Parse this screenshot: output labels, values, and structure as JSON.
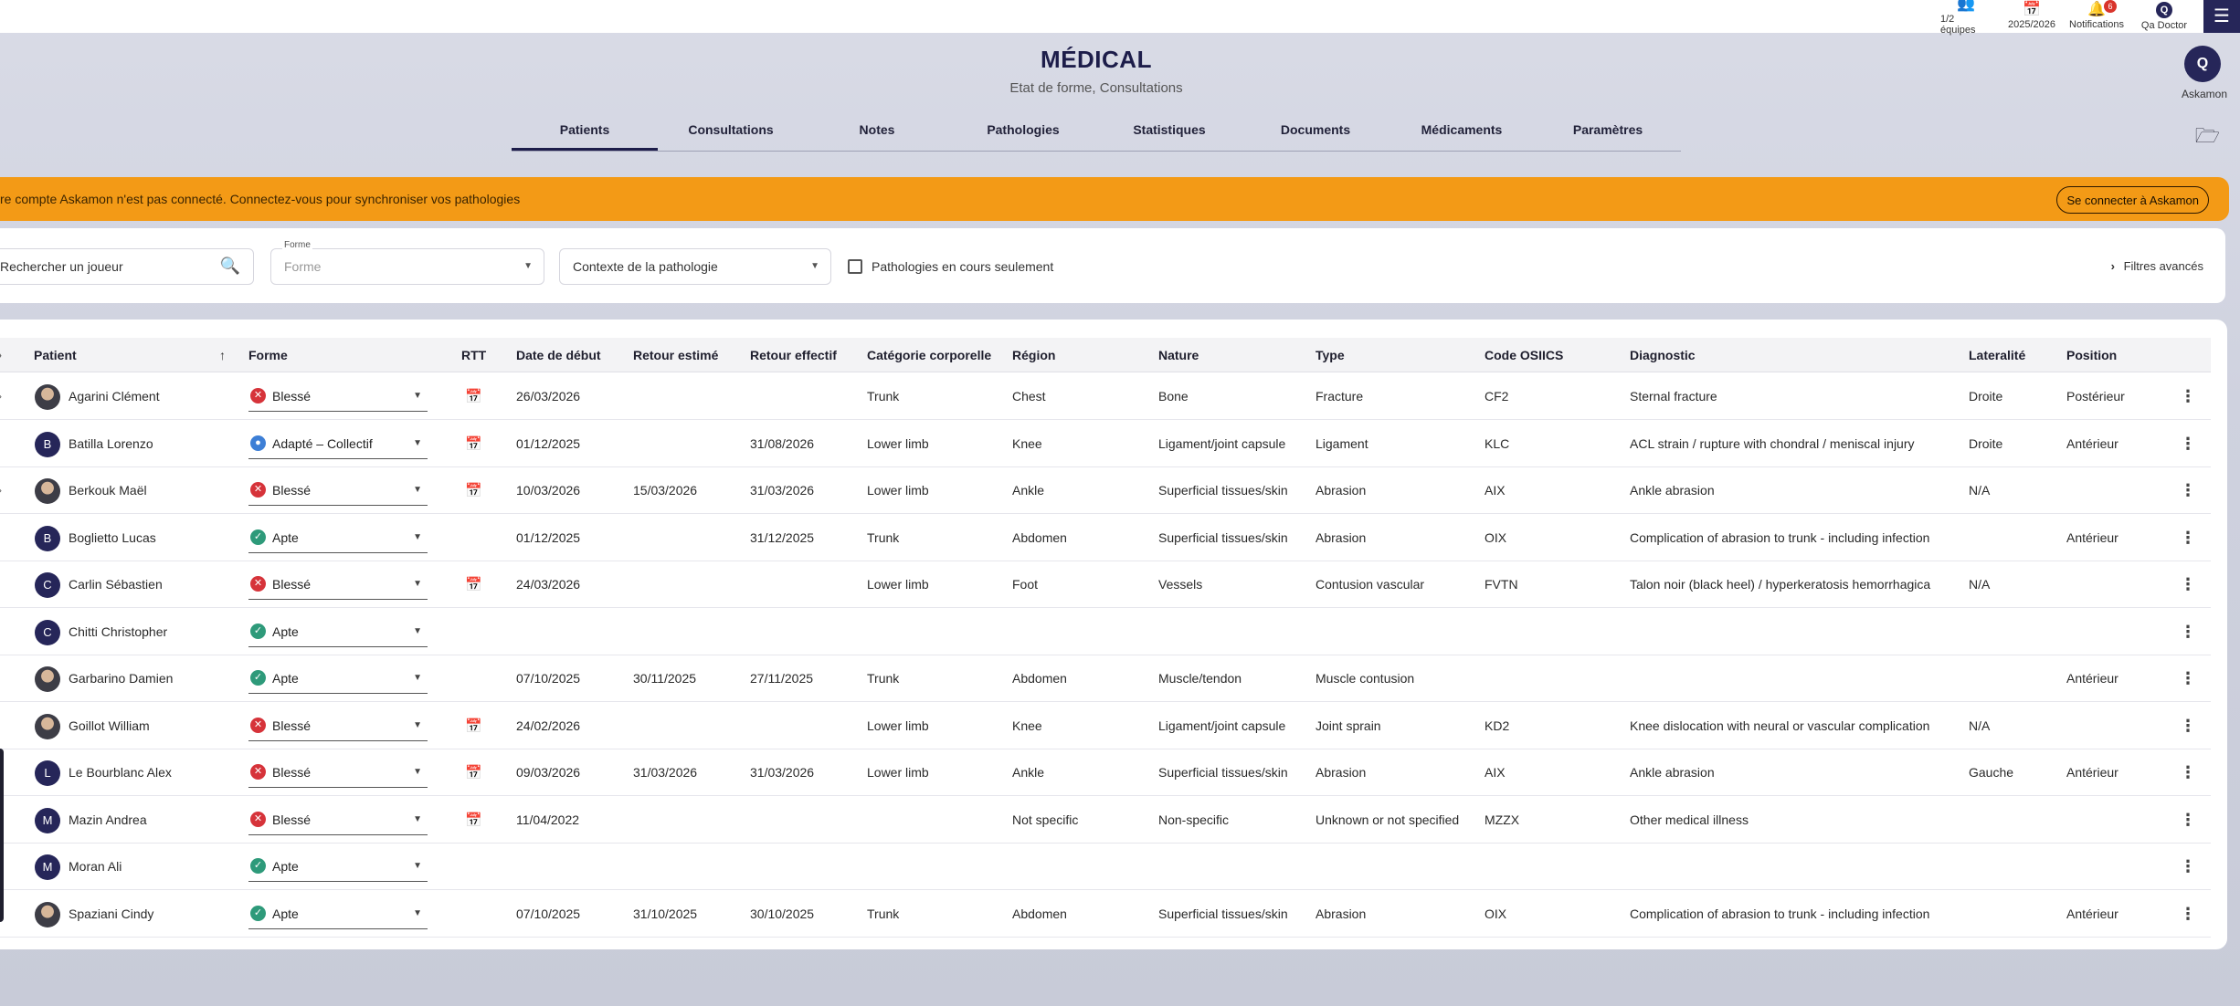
{
  "topbar": {
    "teams_label": "1/2 équipes",
    "season_label": "2025/2026",
    "notifications_label": "Notifications",
    "notifications_count": "6",
    "user_initial": "Q",
    "user_label": "Qa Doctor"
  },
  "side": {
    "askamon_label": "Askamon",
    "askamon_logo": "Q"
  },
  "header": {
    "title": "MÉDICAL",
    "subtitle": "Etat de forme, Consultations"
  },
  "tabs": [
    {
      "label": "Patients",
      "active": true
    },
    {
      "label": "Consultations"
    },
    {
      "label": "Notes"
    },
    {
      "label": "Pathologies"
    },
    {
      "label": "Statistiques"
    },
    {
      "label": "Documents"
    },
    {
      "label": "Médicaments"
    },
    {
      "label": "Paramètres"
    }
  ],
  "banner": {
    "text": "re compte Askamon n'est pas connecté. Connectez-vous pour synchroniser vos pathologies",
    "button": "Se connecter à Askamon",
    "color": "#f39a16"
  },
  "filters": {
    "search_placeholder": "Rechercher un joueur",
    "forme_label": "Forme",
    "forme_placeholder": "Forme",
    "contexte_value": "Contexte de la pathologie",
    "ongoing_label": "Pathologies en cours seulement",
    "advanced_label": "Filtres avancés"
  },
  "table": {
    "headers": {
      "patient": "Patient",
      "forme": "Forme",
      "rtt": "RTT",
      "debut": "Date de début",
      "estime": "Retour estimé",
      "effectif": "Retour effectif",
      "categorie": "Catégorie corporelle",
      "region": "Région",
      "nature": "Nature",
      "type": "Type",
      "code": "Code OSIICS",
      "diagnostic": "Diagnostic",
      "lateralite": "Lateralité",
      "position": "Position"
    },
    "rows": [
      {
        "initial": "",
        "photo": true,
        "expand": true,
        "name": "Agarini Clément",
        "forme": "Blessé",
        "status": "injured",
        "rtt": true,
        "debut": "26/03/2026",
        "estime": "",
        "effectif": "",
        "categorie": "Trunk",
        "region": "Chest",
        "nature": "Bone",
        "type": "Fracture",
        "code": "CF2",
        "diagnostic": "Sternal fracture",
        "lateralite": "Droite",
        "position": "Postérieur"
      },
      {
        "initial": "B",
        "photo": false,
        "expand": false,
        "name": "Batilla Lorenzo",
        "forme": "Adapté – Collectif",
        "status": "adapted",
        "rtt": true,
        "debut": "01/12/2025",
        "estime": "",
        "effectif": "31/08/2026",
        "categorie": "Lower limb",
        "region": "Knee",
        "nature": "Ligament/joint capsule",
        "type": "Ligament",
        "code": "KLC",
        "diagnostic": "ACL strain / rupture with chondral / meniscal injury",
        "lateralite": "Droite",
        "position": "Antérieur"
      },
      {
        "initial": "",
        "photo": true,
        "expand": true,
        "name": "Berkouk Maël",
        "forme": "Blessé",
        "status": "injured",
        "rtt": true,
        "debut": "10/03/2026",
        "estime": "15/03/2026",
        "effectif": "31/03/2026",
        "categorie": "Lower limb",
        "region": "Ankle",
        "nature": "Superficial tissues/skin",
        "type": "Abrasion",
        "code": "AIX",
        "diagnostic": "Ankle abrasion",
        "lateralite": "N/A",
        "position": ""
      },
      {
        "initial": "B",
        "photo": false,
        "expand": false,
        "name": "Boglietto Lucas",
        "forme": "Apte",
        "status": "fit",
        "rtt": false,
        "debut": "01/12/2025",
        "estime": "",
        "effectif": "31/12/2025",
        "categorie": "Trunk",
        "region": "Abdomen",
        "nature": "Superficial tissues/skin",
        "type": "Abrasion",
        "code": "OIX",
        "diagnostic": "Complication of abrasion to trunk - including infection",
        "lateralite": "",
        "position": "Antérieur"
      },
      {
        "initial": "C",
        "photo": false,
        "expand": false,
        "name": "Carlin Sébastien",
        "forme": "Blessé",
        "status": "injured",
        "rtt": true,
        "debut": "24/03/2026",
        "estime": "",
        "effectif": "",
        "categorie": "Lower limb",
        "region": "Foot",
        "nature": "Vessels",
        "type": "Contusion vascular",
        "code": "FVTN",
        "diagnostic": "Talon noir (black heel) / hyperkeratosis hemorrhagica",
        "lateralite": "N/A",
        "position": ""
      },
      {
        "initial": "C",
        "photo": false,
        "expand": false,
        "name": "Chitti Christopher",
        "forme": "Apte",
        "status": "fit",
        "rtt": false,
        "debut": "",
        "estime": "",
        "effectif": "",
        "categorie": "",
        "region": "",
        "nature": "",
        "type": "",
        "code": "",
        "diagnostic": "",
        "lateralite": "",
        "position": ""
      },
      {
        "initial": "",
        "photo": true,
        "expand": false,
        "name": "Garbarino Damien",
        "forme": "Apte",
        "status": "fit",
        "rtt": false,
        "debut": "07/10/2025",
        "estime": "30/11/2025",
        "effectif": "27/11/2025",
        "categorie": "Trunk",
        "region": "Abdomen",
        "nature": "Muscle/tendon",
        "type": "Muscle contusion",
        "code": "",
        "diagnostic": "",
        "lateralite": "",
        "position": "Antérieur"
      },
      {
        "initial": "",
        "photo": true,
        "expand": false,
        "name": "Goillot William",
        "forme": "Blessé",
        "status": "injured",
        "rtt": true,
        "debut": "24/02/2026",
        "estime": "",
        "effectif": "",
        "categorie": "Lower limb",
        "region": "Knee",
        "nature": "Ligament/joint capsule",
        "type": "Joint sprain",
        "code": "KD2",
        "diagnostic": "Knee dislocation with neural or vascular complication",
        "lateralite": "N/A",
        "position": ""
      },
      {
        "initial": "L",
        "photo": false,
        "expand": false,
        "name": "Le Bourblanc Alex",
        "forme": "Blessé",
        "status": "injured",
        "rtt": true,
        "debut": "09/03/2026",
        "estime": "31/03/2026",
        "effectif": "31/03/2026",
        "categorie": "Lower limb",
        "region": "Ankle",
        "nature": "Superficial tissues/skin",
        "type": "Abrasion",
        "code": "AIX",
        "diagnostic": "Ankle abrasion",
        "lateralite": "Gauche",
        "position": "Antérieur"
      },
      {
        "initial": "M",
        "photo": false,
        "expand": false,
        "name": "Mazin Andrea",
        "forme": "Blessé",
        "status": "injured",
        "rtt": true,
        "debut": "11/04/2022",
        "estime": "",
        "effectif": "",
        "categorie": "",
        "region": "Not specific",
        "nature": "Non-specific",
        "type": "Unknown or not specified",
        "code": "MZZX",
        "diagnostic": "Other medical illness",
        "lateralite": "",
        "position": ""
      },
      {
        "initial": "M",
        "photo": false,
        "expand": false,
        "name": "Moran Ali",
        "forme": "Apte",
        "status": "fit",
        "rtt": false,
        "debut": "",
        "estime": "",
        "effectif": "",
        "categorie": "",
        "region": "",
        "nature": "",
        "type": "",
        "code": "",
        "diagnostic": "",
        "lateralite": "",
        "position": ""
      },
      {
        "initial": "",
        "photo": true,
        "expand": false,
        "name": "Spaziani Cindy",
        "forme": "Apte",
        "status": "fit",
        "rtt": false,
        "debut": "07/10/2025",
        "estime": "31/10/2025",
        "effectif": "30/10/2025",
        "categorie": "Trunk",
        "region": "Abdomen",
        "nature": "Superficial tissues/skin",
        "type": "Abrasion",
        "code": "OIX",
        "diagnostic": "Complication of abrasion to trunk - including infection",
        "lateralite": "",
        "position": "Antérieur"
      }
    ]
  },
  "colors": {
    "injured": "#d6333a",
    "adapted": "#3d7fd6",
    "fit": "#2e9a7a",
    "primary": "#262659"
  }
}
